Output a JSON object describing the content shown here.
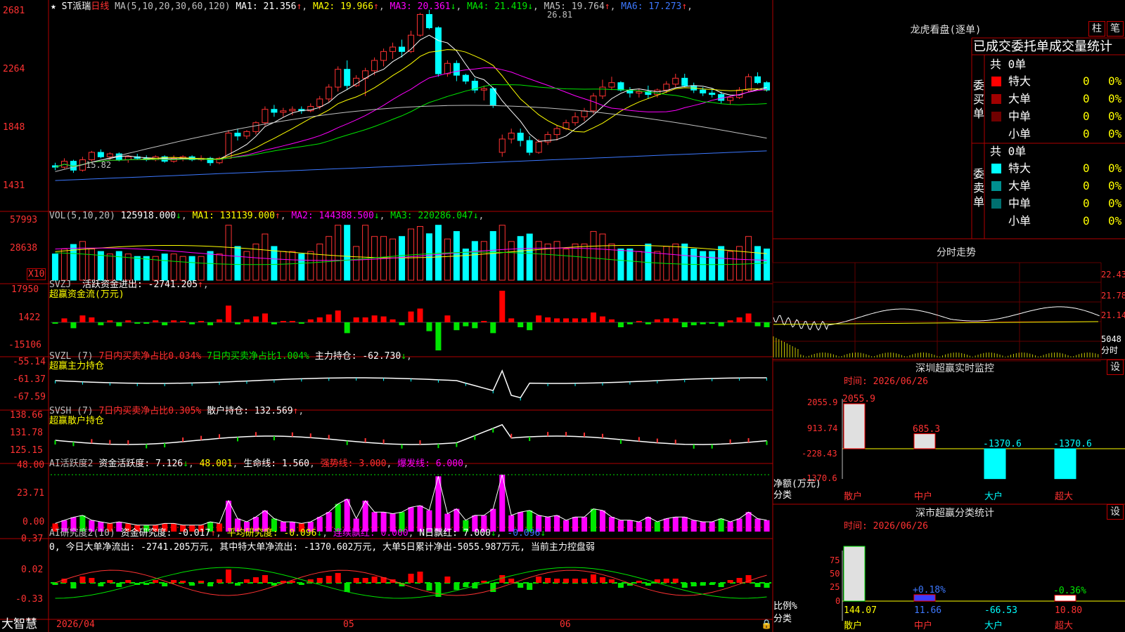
{
  "app": {
    "brand": "大智慧"
  },
  "main": {
    "stock": "ST派瑞",
    "period": "日线",
    "ma_label": "MA(5,10,20,30,60,120)",
    "ma": [
      {
        "label": "MA1: 21.356",
        "arrow": "↑",
        "color": "#ffffff"
      },
      {
        "label": "MA2: 19.966",
        "arrow": "↑",
        "color": "#ffff00"
      },
      {
        "label": "MA3: 20.361",
        "arrow": "↓",
        "color": "#ff00ff"
      },
      {
        "label": "MA4: 21.419",
        "arrow": "↓",
        "color": "#00e600"
      },
      {
        "label": "MA5: 19.764",
        "arrow": "↑",
        "color": "#c0c0c0"
      },
      {
        "label": "MA6: 17.273",
        "arrow": "↑",
        "color": "#3c78ff"
      }
    ],
    "yticks": [
      "2681",
      "2264",
      "1848",
      "1431"
    ],
    "high_label": "26.81",
    "low_label": "15.82"
  },
  "vol": {
    "name": "VOL(5,10,20)",
    "value": "125918.000",
    "ma": [
      {
        "label": "MA1: 131139.000",
        "arrow": "↑",
        "color": "#ffff00"
      },
      {
        "label": "MA2: 144388.500",
        "arrow": "↓",
        "color": "#ff00ff"
      },
      {
        "label": "MA3: 220286.047",
        "arrow": "↓",
        "color": "#00e600"
      }
    ],
    "yticks": [
      "57993",
      "28638"
    ],
    "unit": "X10"
  },
  "svzj": {
    "name": "SVZJ",
    "line1": "活跃资金进出: -2741.205",
    "arrow": "↑",
    "sub": "超赢资金流(万元)",
    "yticks": [
      "17950",
      "1422",
      "-15106"
    ]
  },
  "svzl": {
    "name": "SVZL (7)",
    "p1": "7日内买卖净占比0.034%",
    "p2": "7日内买卖净占比1.004%",
    "p3": "主力持仓: -62.730",
    "arrow": "↓",
    "sub": "超赢主力持仓",
    "yticks": [
      "-55.14",
      "-61.37",
      "-67.59"
    ]
  },
  "svsh": {
    "name": "SVSH (7)",
    "p1": "7日内买卖净占比0.305%",
    "p2": "散户持仓: 132.569",
    "arrow": "↑",
    "sub": "超赢散户持仓",
    "yticks": [
      "138.66",
      "131.78",
      "125.15"
    ]
  },
  "ai2": {
    "name": "AI活跃度2",
    "p1": "资金活跃度: 7.126",
    "p2": "48.001",
    "p3": "生命线: 1.560",
    "p4": "强势线: 3.000",
    "p5": "爆发线: 6.000",
    "yticks": [
      "48.00",
      "23.71",
      "0.00"
    ]
  },
  "ai3": {
    "name": "AI研究度2(10)",
    "p1": "资金研究度: -0.017",
    "p2": "平均研究度: -0.096",
    "p3": "连续飘红: 0.000",
    "p4": "N日飘红: 7.000",
    "p5": "-0.096",
    "summary": "0, 今日大单净流出: -2741.205万元, 其中特大单净流出: -1370.602万元, 大单5日累计净出-5055.987万元, 当前主力控盘弱",
    "yticks": [
      "0.37",
      "0.02",
      "-0.33"
    ]
  },
  "xaxis": [
    "2026/04",
    "05",
    "06"
  ],
  "right": {
    "dragon": {
      "title": "龙虎看盘(逐单)",
      "btn1": "柱",
      "btn2": "笔",
      "header": "已成交委托单成交量统计",
      "buy": {
        "label": "委买单",
        "total": "共 0单",
        "rows": [
          {
            "name": "特大",
            "val": "0",
            "pct": "0%",
            "color": "#ff0000"
          },
          {
            "name": "大单",
            "val": "0",
            "pct": "0%",
            "color": "#a00000"
          },
          {
            "name": "中单",
            "val": "0",
            "pct": "0%",
            "color": "#700000"
          },
          {
            "name": "小单",
            "val": "0",
            "pct": "0%",
            "color": ""
          }
        ]
      },
      "sell": {
        "label": "委卖单",
        "total": "共 0单",
        "rows": [
          {
            "name": "特大",
            "val": "0",
            "pct": "0%",
            "color": "#00ffff"
          },
          {
            "name": "大单",
            "val": "0",
            "pct": "0%",
            "color": "#009090"
          },
          {
            "name": "中单",
            "val": "0",
            "pct": "0%",
            "color": "#007070"
          },
          {
            "name": "小单",
            "val": "0",
            "pct": "0%",
            "color": ""
          }
        ]
      }
    },
    "intraday": {
      "title": "分时走势",
      "yticks": [
        "22.43",
        "21.78",
        "21.14"
      ],
      "vol_tick": "5048",
      "unit": "分时"
    },
    "realtime": {
      "title": "深圳超赢实时监控",
      "btn": "设",
      "date": "时间: 2026/06/26",
      "yticks": [
        "2055.9",
        "913.74",
        "-228.43",
        "-1370.6"
      ],
      "ylabel": "净额(万元)",
      "xlabel": "分类",
      "bars": [
        {
          "cat": "散户",
          "val": 2055.9,
          "label": "2055.9"
        },
        {
          "cat": "中户",
          "val": 685.3,
          "label": "685.3"
        },
        {
          "cat": "大户",
          "val": -1370.6,
          "label": "-1370.6"
        },
        {
          "cat": "超大",
          "val": -1370.6,
          "label": "-1370.6"
        }
      ]
    },
    "category": {
      "title": "深市超赢分类统计",
      "btn": "设",
      "date": "时间: 2026/06/26",
      "yticks": [
        "75",
        "50",
        "25",
        "0"
      ],
      "ylabel": "比例%",
      "xlabel": "分类",
      "bars": [
        {
          "cat": "散户",
          "val": 144.07,
          "label": "144.07"
        },
        {
          "cat": "中户",
          "val": 11.66,
          "label": "11.66",
          "pct": "+0.18%"
        },
        {
          "cat": "大户",
          "val": -66.53,
          "label": "-66.53"
        },
        {
          "cat": "超大",
          "val": 10.8,
          "label": "10.80",
          "pct": "-0.36%"
        }
      ]
    }
  },
  "colors": {
    "up": "#ff3232",
    "down": "#00ffff",
    "grid": "#b00000",
    "text": "#c0c0c0"
  },
  "chart_data": {
    "type": "candlestick",
    "ohlc": [
      [
        16.3,
        16.5,
        16.0,
        16.2
      ],
      [
        16.2,
        16.8,
        16.1,
        16.6
      ],
      [
        16.6,
        16.7,
        15.82,
        16.0
      ],
      [
        16.0,
        16.9,
        15.9,
        16.7
      ],
      [
        16.7,
        17.3,
        16.6,
        17.2
      ],
      [
        17.2,
        17.4,
        16.8,
        16.9
      ],
      [
        16.9,
        17.2,
        16.7,
        17.1
      ],
      [
        17.1,
        17.2,
        16.6,
        16.7
      ],
      [
        16.7,
        17.0,
        16.5,
        16.9
      ],
      [
        16.9,
        17.1,
        16.7,
        16.8
      ],
      [
        16.8,
        17.0,
        16.6,
        16.7
      ],
      [
        16.7,
        17.0,
        16.6,
        16.9
      ],
      [
        16.9,
        17.0,
        16.5,
        16.6
      ],
      [
        16.6,
        17.0,
        16.5,
        16.8
      ],
      [
        16.8,
        17.0,
        16.6,
        16.9
      ],
      [
        16.9,
        17.0,
        16.6,
        16.7
      ],
      [
        16.7,
        17.0,
        16.6,
        16.8
      ],
      [
        16.8,
        16.9,
        16.3,
        16.5
      ],
      [
        16.5,
        16.9,
        16.4,
        16.8
      ],
      [
        16.8,
        18.7,
        16.8,
        18.5
      ],
      [
        18.5,
        18.8,
        18.0,
        18.3
      ],
      [
        18.3,
        18.7,
        18.1,
        18.6
      ],
      [
        18.6,
        19.3,
        18.4,
        19.2
      ],
      [
        19.2,
        20.3,
        19.0,
        20.1
      ],
      [
        20.1,
        20.4,
        19.6,
        19.9
      ],
      [
        19.9,
        20.2,
        19.6,
        20.0
      ],
      [
        20.0,
        20.3,
        19.7,
        20.1
      ],
      [
        20.1,
        20.3,
        19.8,
        20.0
      ],
      [
        20.0,
        20.5,
        19.9,
        20.3
      ],
      [
        20.3,
        21.0,
        20.1,
        20.8
      ],
      [
        20.8,
        21.8,
        20.6,
        21.6
      ],
      [
        21.6,
        23.0,
        21.3,
        22.8
      ],
      [
        22.8,
        23.4,
        21.4,
        21.7
      ],
      [
        21.7,
        22.4,
        21.6,
        22.2
      ],
      [
        22.2,
        22.9,
        21.0,
        22.7
      ],
      [
        22.7,
        23.6,
        22.4,
        23.4
      ],
      [
        23.4,
        24.2,
        23.0,
        24.0
      ],
      [
        24.0,
        24.6,
        23.5,
        24.3
      ],
      [
        24.3,
        24.8,
        23.6,
        24.0
      ],
      [
        24.0,
        25.4,
        23.9,
        25.1
      ],
      [
        25.1,
        26.6,
        25.0,
        26.5
      ],
      [
        26.5,
        26.81,
        25.5,
        25.6
      ],
      [
        25.6,
        25.7,
        22.3,
        22.5
      ],
      [
        22.5,
        23.4,
        22.3,
        23.2
      ],
      [
        23.2,
        23.4,
        22.0,
        22.4
      ],
      [
        22.4,
        22.5,
        21.8,
        22.0
      ],
      [
        22.0,
        22.2,
        21.2,
        21.4
      ],
      [
        21.4,
        21.7,
        20.7,
        21.5
      ],
      [
        21.5,
        21.6,
        20.2,
        20.4
      ],
      [
        17.2,
        18.4,
        16.9,
        18.1
      ],
      [
        18.1,
        18.8,
        17.8,
        18.5
      ],
      [
        18.5,
        18.8,
        17.6,
        18.0
      ],
      [
        18.0,
        18.3,
        17.0,
        17.2
      ],
      [
        17.2,
        18.1,
        17.1,
        17.9
      ],
      [
        17.9,
        18.6,
        17.7,
        18.4
      ],
      [
        18.4,
        19.0,
        18.0,
        18.8
      ],
      [
        18.8,
        19.4,
        18.7,
        19.2
      ],
      [
        19.2,
        19.9,
        19.0,
        19.6
      ],
      [
        19.6,
        20.2,
        19.3,
        20.0
      ],
      [
        20.0,
        21.2,
        19.8,
        21.0
      ],
      [
        21.0,
        22.1,
        20.8,
        21.6
      ],
      [
        21.6,
        22.3,
        21.4,
        21.9
      ],
      [
        21.9,
        22.0,
        21.3,
        21.4
      ],
      [
        21.4,
        21.6,
        20.9,
        21.2
      ],
      [
        21.2,
        21.5,
        20.9,
        21.3
      ],
      [
        21.3,
        21.7,
        20.8,
        21.1
      ],
      [
        21.1,
        21.5,
        20.9,
        21.4
      ],
      [
        21.4,
        22.0,
        21.2,
        21.8
      ],
      [
        21.8,
        22.5,
        21.6,
        22.2
      ],
      [
        22.2,
        22.5,
        21.6,
        21.7
      ],
      [
        21.7,
        21.9,
        21.2,
        21.4
      ],
      [
        21.4,
        21.6,
        21.0,
        21.2
      ],
      [
        21.2,
        21.5,
        20.9,
        21.1
      ],
      [
        21.1,
        21.3,
        20.5,
        20.7
      ],
      [
        20.7,
        21.0,
        20.4,
        20.9
      ],
      [
        20.9,
        21.6,
        20.8,
        21.4
      ],
      [
        21.4,
        22.5,
        21.3,
        22.3
      ],
      [
        22.3,
        22.6,
        21.8,
        21.9
      ],
      [
        21.9,
        22.0,
        21.3,
        21.4
      ]
    ],
    "ylim": [
      14.31,
      26.81
    ]
  }
}
